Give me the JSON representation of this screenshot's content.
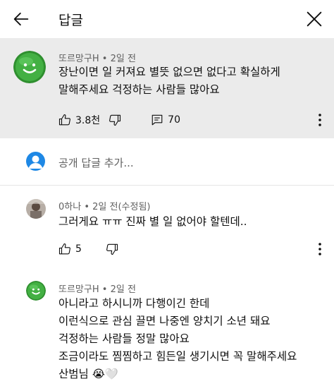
{
  "header": {
    "title": "답글"
  },
  "parent_comment": {
    "author": "또르망구H",
    "time": "2일 전",
    "lines": [
      "장난이면 일 커져요 별뜻 없으면 없다고 확실하게",
      "말해주세요 걱정하는 사람들 많아요"
    ],
    "likes": "3.8천",
    "replies": "70"
  },
  "add_reply": {
    "placeholder": "공개 답글 추가..."
  },
  "replies": [
    {
      "author": "0하나",
      "time": "2일 전(수정됨)",
      "lines": [
        "그러게요 ㅠㅠ 진짜 별 일 없어야 할텐데.."
      ],
      "likes": "5"
    },
    {
      "author": "또르망구H",
      "time": "2일 전",
      "lines": [
        "아니라고 하시니까 다행이긴 한데",
        "이런식으로 관심 끌면 나중엔 양치기 소년 돼요",
        "걱정하는 사람들 정말 많아요",
        "조금이라도 찜찜하고 힘든일 생기시면 꼭 말해주세요",
        "산범님 😭🤍"
      ]
    }
  ],
  "colors": {
    "highlight_bg": "#ebebeb",
    "avatar_green": "#3aa33a",
    "meta_gray": "#606060"
  },
  "icons": [
    "back-arrow-icon",
    "close-icon",
    "thumbs-up-icon",
    "thumbs-down-icon",
    "reply-icon",
    "more-vert-icon",
    "user-avatar-icon"
  ]
}
